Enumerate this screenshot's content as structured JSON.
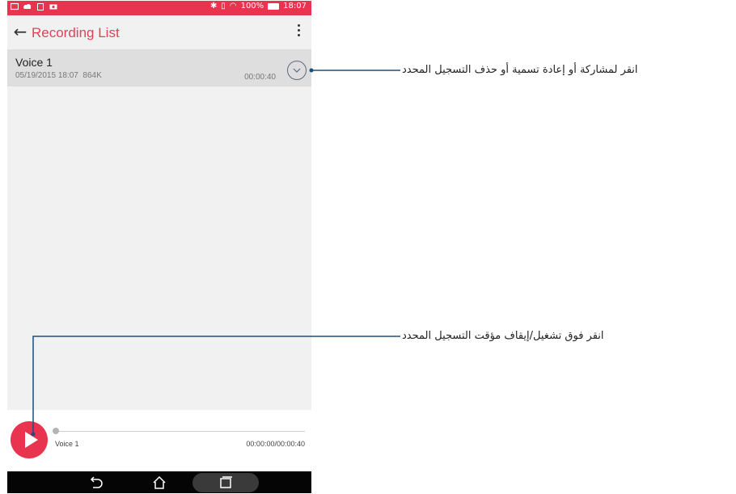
{
  "status_bar": {
    "battery_text": "100%",
    "time": "18:07"
  },
  "app_bar": {
    "title": "Recording List"
  },
  "recordings": [
    {
      "name": "Voice 1",
      "date": "05/19/2015 18:07",
      "size": "864K",
      "duration": "00:00:40"
    }
  ],
  "player": {
    "title": "Voice 1",
    "time": "00:00:00/00:00:40"
  },
  "callouts": {
    "menu": "انقر لمشاركة أو إعادة تسمية أو حذف التسجيل المحدد",
    "play": "انقر فوق تشغيل/إيقاف مؤقت التسجيل المحدد"
  },
  "colors": {
    "accent": "#e8344e",
    "title": "#e0405a",
    "callout_line": "#1f4e79"
  }
}
